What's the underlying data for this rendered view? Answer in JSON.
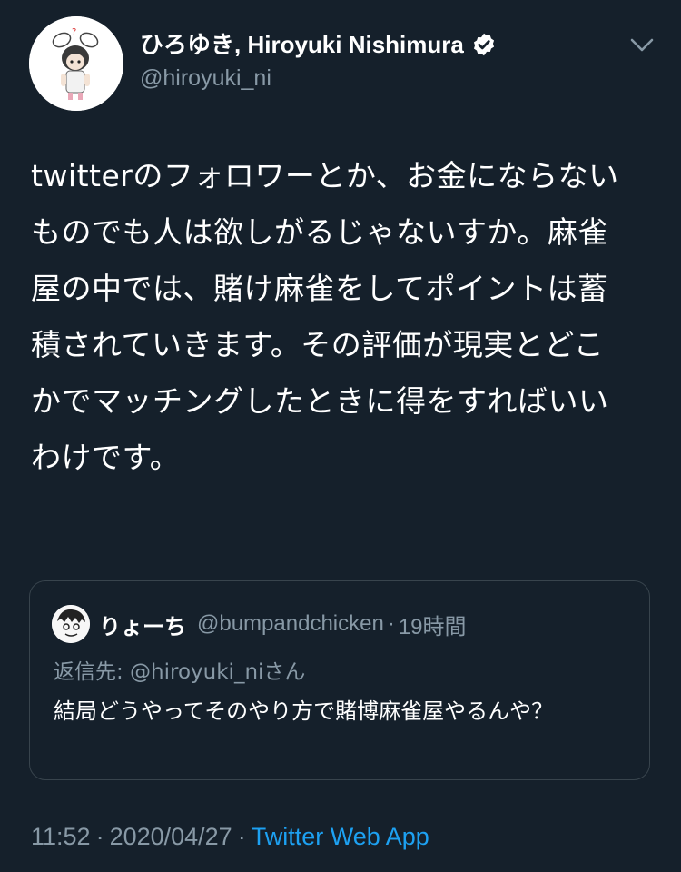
{
  "tweet": {
    "author": {
      "display_name": "ひろゆき, Hiroyuki Nishimura",
      "handle": "@hiroyuki_ni",
      "verified": true,
      "avatar_icon": "bunny-ear-character-avatar"
    },
    "more_icon": "chevron-down-icon",
    "text": "twitterのフォロワーとか、お金にならないものでも人は欲しがるじゃないすか。麻雀屋の中では、賭け麻雀をしてポイントは蓄積されていきます。その評価が現実とどこかでマッチングしたときに得をすればいいわけです。",
    "quoted": {
      "display_name": "りょーち",
      "handle": "@bumpandchicken",
      "time": "19時間",
      "reply_to": "返信先: @hiroyuki_niさん",
      "text": "結局どうやってそのやり方で賭博麻雀屋やるんや？"
    },
    "timestamp": {
      "time": "11:52",
      "date": "2020/04/27",
      "source": "Twitter Web App"
    }
  },
  "colors": {
    "background": "#15202b",
    "secondary_text": "#8899a6",
    "accent": "#1da1f2",
    "border": "#38444d"
  }
}
